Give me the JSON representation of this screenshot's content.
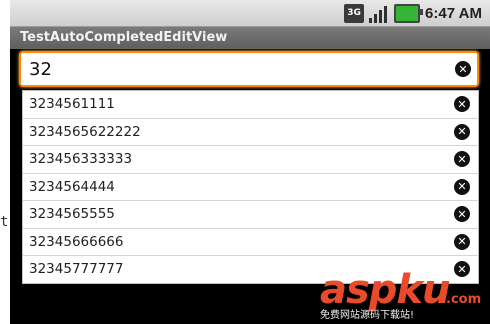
{
  "background": {
    "text_fragment": "t'"
  },
  "status_bar": {
    "network_label": "3G",
    "time": "6:47 AM",
    "battery_color": "#36b436"
  },
  "title_bar": {
    "title": "TestAutoCompletedEditView"
  },
  "edit": {
    "value": "32",
    "clear_icon": "close-circle-icon",
    "focus_color": "#ff8a00"
  },
  "suggestions": [
    {
      "text": "3234561111"
    },
    {
      "text": "3234565622222"
    },
    {
      "text": "323456333333"
    },
    {
      "text": "3234564444"
    },
    {
      "text": "3234565555"
    },
    {
      "text": "32345666666"
    },
    {
      "text": "32345777777"
    }
  ],
  "watermark": {
    "logo": "aspku",
    "suffix": ".com",
    "sub": "免费网站源码下载站!"
  }
}
